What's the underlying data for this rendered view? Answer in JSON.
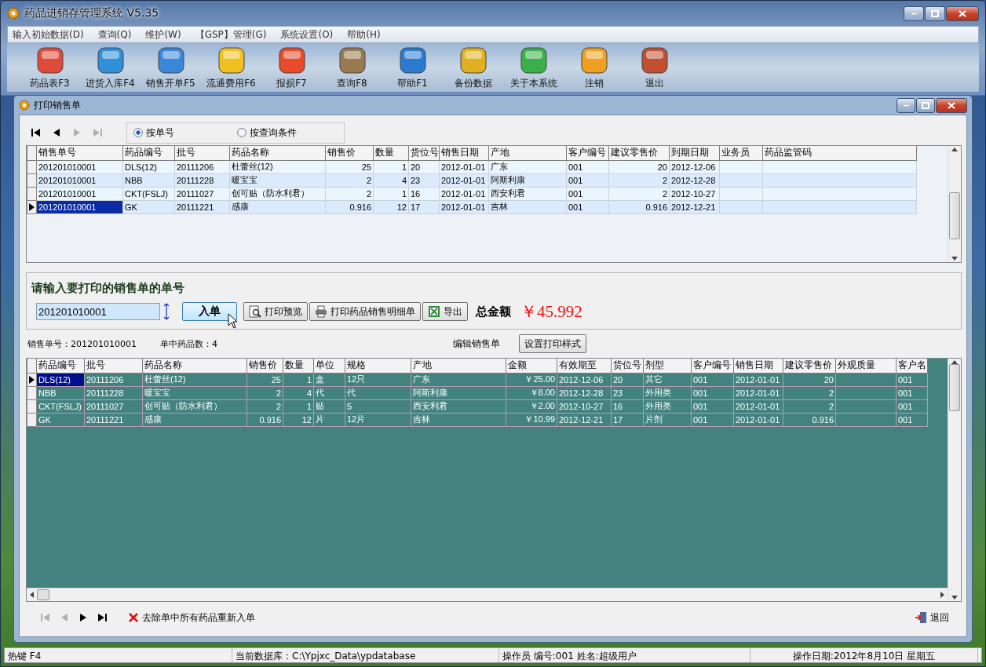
{
  "window": {
    "title": "药品进销存管理系统 V5.35"
  },
  "menu": [
    "输入初始数据(D)",
    "查询(Q)",
    "维护(W)",
    "【GSP】管理(G)",
    "系统设置(O)",
    "帮助(H)"
  ],
  "toolbar": [
    {
      "label": "药品表F3"
    },
    {
      "label": "进货入库F4"
    },
    {
      "label": "销售开单F5"
    },
    {
      "label": "流通费用F6"
    },
    {
      "label": "报损F7"
    },
    {
      "label": "查询F8"
    },
    {
      "label": "帮助F1"
    },
    {
      "label": "备份数据"
    },
    {
      "label": "关于本系统"
    },
    {
      "label": "注销"
    },
    {
      "label": "退出"
    }
  ],
  "dialog": {
    "title": "打印销售单"
  },
  "record_nav": [
    {
      "kind": "first",
      "disabled": false
    },
    {
      "kind": "prev",
      "disabled": false
    },
    {
      "kind": "next",
      "disabled": true
    },
    {
      "kind": "last",
      "disabled": true
    }
  ],
  "search_mode": [
    {
      "label": "按单号",
      "selected": true
    },
    {
      "label": "按查询条件",
      "selected": false
    }
  ],
  "sales_table": {
    "columns": [
      "销售单号",
      "药品编号",
      "批号",
      "药品名称",
      "销售价",
      "数量",
      "货位号",
      "销售日期",
      "产地",
      "客户编号",
      "建议零售价",
      "到期日期",
      "业务员",
      "药品监管码"
    ],
    "rows": [
      {
        "selected": false,
        "cells": [
          "201201010001",
          "DLS(12)",
          "20111206",
          "杜蕾丝(12)",
          "25",
          "1",
          "20",
          "2012-01-01",
          "广东",
          "001",
          "20",
          "2012-12-06",
          "",
          ""
        ]
      },
      {
        "selected": false,
        "cells": [
          "201201010001",
          "NBB",
          "20111228",
          "暖宝宝",
          "2",
          "4",
          "23",
          "2012-01-01",
          "阿斯利康",
          "001",
          "2",
          "2012-12-28",
          "",
          ""
        ]
      },
      {
        "selected": false,
        "cells": [
          "201201010001",
          "CKT(FSLJ)",
          "20111027",
          "创可贴（防水利君）",
          "2",
          "1",
          "16",
          "2012-01-01",
          "西安利君",
          "001",
          "2",
          "2012-10-27",
          "",
          ""
        ]
      },
      {
        "selected": true,
        "cells": [
          "201201010001",
          "GK",
          "20111221",
          "感康",
          "0.916",
          "12",
          "17",
          "2012-01-01",
          "吉林",
          "001",
          "0.916",
          "2012-12-21",
          "",
          ""
        ]
      }
    ]
  },
  "input_panel": {
    "prompt": "请输入要打印的销售单的单号",
    "order_field": {
      "value": "201201010001"
    },
    "buttons": [
      {
        "kind": "enter",
        "label": "入单"
      },
      {
        "kind": "preview",
        "label": "打印预览"
      },
      {
        "kind": "print",
        "label": "打印药品销售明细单"
      },
      {
        "kind": "export",
        "label": "导出"
      }
    ],
    "total_label": "总金额",
    "total_value": "￥45.992"
  },
  "order_info": [
    "销售单号：201201010001",
    "单中药品数：4"
  ],
  "edit_label": "编辑销售单",
  "print_style_button": "设置打印样式",
  "items_table": {
    "columns": [
      "药品编号",
      "批号",
      "药品名称",
      "销售价",
      "数量",
      "单位",
      "规格",
      "产地",
      "金额",
      "有效期至",
      "货位号",
      "剂型",
      "客户编号",
      "销售日期",
      "建议零售价",
      "外观质量",
      "客户名"
    ],
    "rows": [
      {
        "selected": true,
        "cells": [
          "DLS(12)",
          "20111206",
          "杜蕾丝(12)",
          "25",
          "1",
          "盒",
          "12只",
          "广东",
          "￥25.00",
          "2012-12-06",
          "20",
          "其它",
          "001",
          "2012-01-01",
          "20",
          "",
          "001"
        ]
      },
      {
        "selected": false,
        "cells": [
          "NBB",
          "20111228",
          "暖宝宝",
          "2",
          "4",
          "代",
          "代",
          "阿斯利康",
          "￥8.00",
          "2012-12-28",
          "23",
          "外用类",
          "001",
          "2012-01-01",
          "2",
          "",
          "001"
        ]
      },
      {
        "selected": false,
        "cells": [
          "CKT(FSLJ)",
          "20111027",
          "创可贴（防水利君）",
          "2",
          "1",
          "贴",
          "5",
          "西安利君",
          "￥2.00",
          "2012-10-27",
          "16",
          "外用类",
          "001",
          "2012-01-01",
          "2",
          "",
          "001"
        ]
      },
      {
        "selected": false,
        "cells": [
          "GK",
          "20111221",
          "感康",
          "0.916",
          "12",
          "片",
          "12片",
          "吉林",
          "￥10.99",
          "2012-12-21",
          "17",
          "片剂",
          "001",
          "2012-01-01",
          "0.916",
          "",
          "001"
        ]
      }
    ]
  },
  "bottom_nav": [
    {
      "kind": "first",
      "disabled": true
    },
    {
      "kind": "prev",
      "disabled": true
    },
    {
      "kind": "next",
      "disabled": false
    },
    {
      "kind": "last",
      "disabled": false
    }
  ],
  "reset_button": "去除单中所有药品重新入单",
  "return_button": "退回",
  "status_bar": [
    "热键 F4",
    "当前数据库：C:\\Ypjxc_Data\\ypdatabase",
    "操作员 编号:001  姓名:超级用户",
    "操作日期:2012年8月10日 星期五"
  ]
}
